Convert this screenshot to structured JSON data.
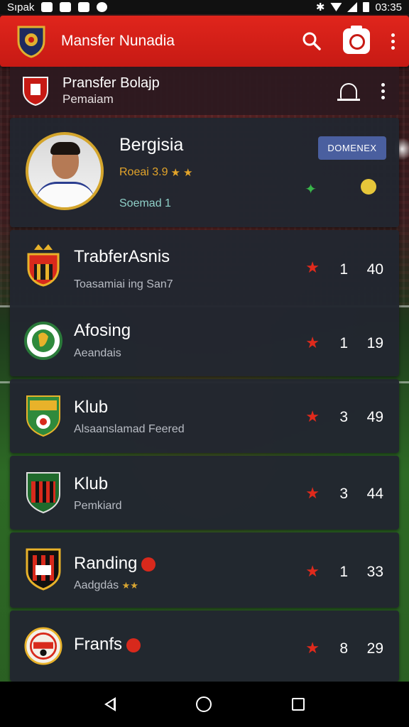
{
  "status_bar": {
    "carrier": "Sıpak",
    "time": "03:35"
  },
  "app_bar": {
    "title": "Mansfer Nunadia"
  },
  "sub_header": {
    "title": "Pransfer Bolajp",
    "subtitle": "Pemaiam"
  },
  "player": {
    "name": "Bergisia",
    "stat": "Roeai 3.9",
    "meta": "Soemad 1",
    "badge": "DOMENEX"
  },
  "clubs": [
    {
      "name": "TrabferAsnis",
      "sub": "Toasamiai ing San7",
      "count": "1",
      "value": "40"
    },
    {
      "name": "Afosing",
      "sub": "Aeandais",
      "count": "1",
      "value": "19"
    },
    {
      "name": "Klub",
      "sub": "Alsaanslamad Feered",
      "count": "3",
      "value": "49"
    },
    {
      "name": "Klub",
      "sub": "Pemkiard",
      "count": "3",
      "value": "44"
    },
    {
      "name": "Randing",
      "sub": "Aadgdás",
      "count": "1",
      "value": "33"
    },
    {
      "name": "Franfs",
      "sub": "",
      "count": "8",
      "value": "29"
    }
  ],
  "colors": {
    "app_bar": "#d8231a",
    "star": "#e02a1c",
    "gold": "#d4a52c",
    "card": "#222630",
    "badge": "#4a5f9f"
  },
  "icons": [
    "search-icon",
    "camera-icon",
    "more-vert-icon",
    "bell-icon",
    "star-icon",
    "back-icon",
    "home-icon",
    "recents-icon"
  ]
}
